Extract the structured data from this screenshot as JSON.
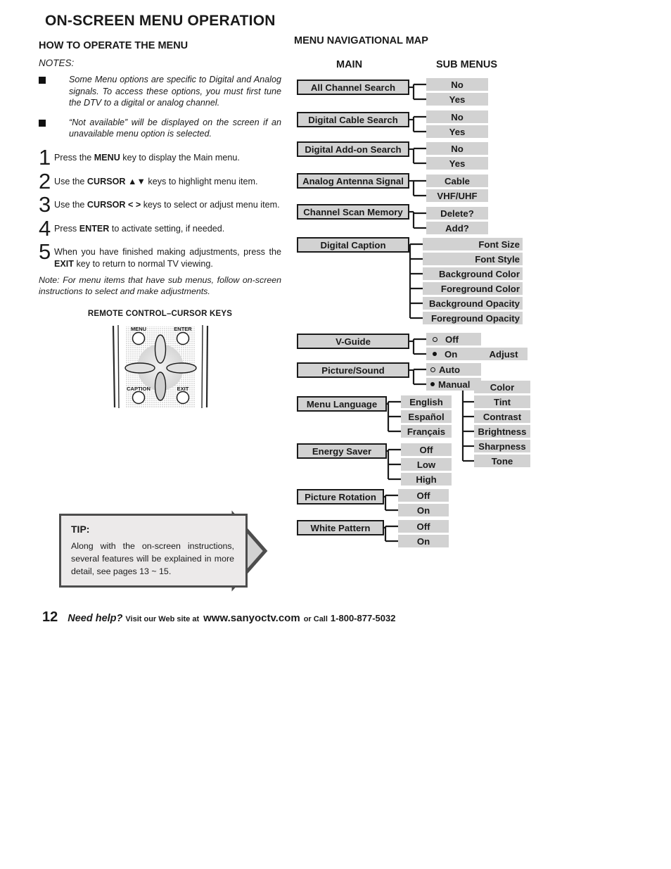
{
  "page_title": "ON-SCREEN MENU OPERATION",
  "left": {
    "section_heading": "HOW TO OPERATE THE MENU",
    "notes_label": "NOTES:",
    "notes": [
      "Some Menu options are specific to Digital and Analog signals. To access these options, you must first tune the DTV to a digital or analog channel.",
      "“Not available” will be displayed on the screen if an unavailable menu option is selected."
    ],
    "steps": [
      {
        "num": "1",
        "html": "Press the <b>MENU</b> key to display the Main menu."
      },
      {
        "num": "2",
        "html": "Use the <b>CURSOR ▲▼</b> keys to highlight menu item."
      },
      {
        "num": "3",
        "html": "Use the <b>CURSOR &lt; &gt;</b> keys to select or adjust menu item."
      },
      {
        "num": "4",
        "html": "Press <b>ENTER</b> to activate setting, if needed."
      },
      {
        "num": "5",
        "html": "When you have finished making adjustments, press the <b>EXIT</b> key to return to normal TV viewing."
      }
    ],
    "note_lead": "Note:",
    "note_body": "For menu items that have sub menus, follow on-screen instructions to select and make adjustments.",
    "remote_caption": "REMOTE CONTROL–CURSOR KEYS",
    "remote_keys": {
      "menu": "MENU",
      "enter": "ENTER",
      "caption": "CAPTION",
      "exit": "EXIT"
    }
  },
  "tip": {
    "title": "TIP:",
    "body": "Along with the on-screen instructions, several features will be explained in more detail, see pages 13 ~ 15."
  },
  "footer": {
    "page_number": "12",
    "need_help": "Need help?",
    "visit": "Visit our Web site at",
    "url": "www.sanyoctv.com",
    "or_call": "or Call",
    "phone": "1-800-877-5032"
  },
  "map": {
    "heading": "MENU NAVIGATIONAL MAP",
    "col_main": "MAIN",
    "col_sub": "SUB MENUS",
    "entries": [
      {
        "main": "All Channel Search",
        "subs": [
          "No",
          "Yes"
        ]
      },
      {
        "main": "Digital Cable Search",
        "subs": [
          "No",
          "Yes"
        ]
      },
      {
        "main": "Digital Add-on Search",
        "subs": [
          "No",
          "Yes"
        ]
      },
      {
        "main": "Analog Antenna Signal",
        "subs": [
          "Cable",
          "VHF/UHF"
        ]
      },
      {
        "main": "Channel Scan Memory",
        "subs": [
          "Delete?",
          "Add?"
        ]
      },
      {
        "main": "Digital Caption",
        "subs": [
          "Font Size",
          "Font Style",
          "Background Color",
          "Foreground Color",
          "Background Opacity",
          "Foreground Opacity"
        ]
      },
      {
        "main": "V-Guide",
        "subs": [
          "Off",
          "On"
        ],
        "third": [
          "Adjust"
        ]
      },
      {
        "main": "Picture/Sound",
        "subs": [
          "Auto",
          "Manual"
        ],
        "third": [
          "Color",
          "Tint",
          "Contrast",
          "Brightness",
          "Sharpness",
          "Tone"
        ]
      },
      {
        "main": "Menu Language",
        "subs": [
          "English",
          "Español",
          "Français"
        ]
      },
      {
        "main": "Energy Saver",
        "subs": [
          "Off",
          "Low",
          "High"
        ]
      },
      {
        "main": "Picture Rotation",
        "subs": [
          "Off",
          "On"
        ]
      },
      {
        "main": "White Pattern",
        "subs": [
          "Off",
          "On"
        ]
      }
    ]
  },
  "colors": {
    "box_fill": "#d2d2d2",
    "box_border": "#1a1a1a",
    "tip_fill": "#eceaea",
    "tip_border": "#4d4d4d"
  }
}
